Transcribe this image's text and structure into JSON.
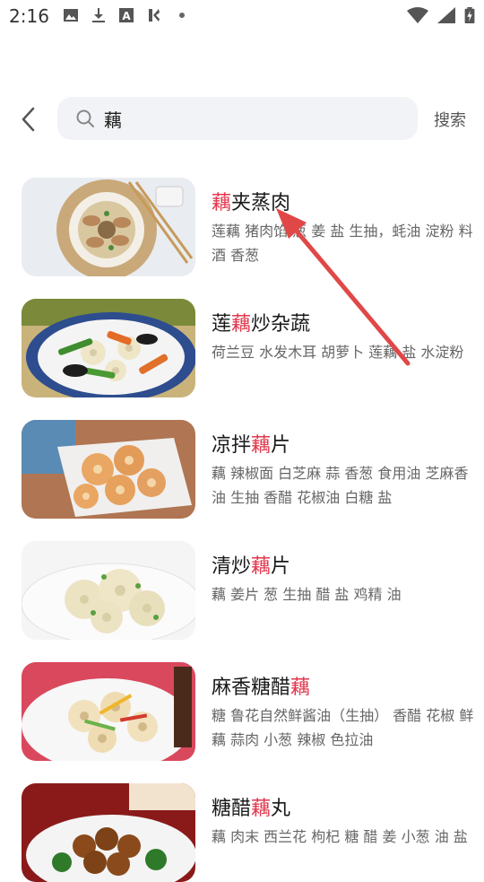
{
  "status_bar": {
    "time": "2:16",
    "left_icons": [
      "image-icon",
      "download-icon",
      "font-app-icon",
      "k-app-icon",
      "dot-icon"
    ],
    "right_icons": [
      "wifi-icon",
      "signal-icon",
      "battery-charging-icon"
    ]
  },
  "search": {
    "query": "藕",
    "button_label": "搜索"
  },
  "colors": {
    "highlight": "#e23a4f",
    "search_bg": "#f1f3f6",
    "arrow": "#e04848"
  },
  "results": [
    {
      "title_pre": "",
      "title_hl": "藕",
      "title_post": "夹蒸肉",
      "ingredients": "莲藕 猪肉馅 葱 姜 盐 生抽，蚝油 淀粉 料酒 香葱"
    },
    {
      "title_pre": "莲",
      "title_hl": "藕",
      "title_post": "炒杂蔬",
      "ingredients": "荷兰豆 水发木耳 胡萝卜 莲藕 盐 水淀粉"
    },
    {
      "title_pre": "凉拌",
      "title_hl": "藕",
      "title_post": "片",
      "ingredients": "藕 辣椒面 白芝麻 蒜 香葱 食用油 芝麻香油 生抽 香醋 花椒油 白糖 盐"
    },
    {
      "title_pre": "清炒",
      "title_hl": "藕",
      "title_post": "片",
      "ingredients": "藕 姜片 葱 生抽 醋 盐 鸡精 油"
    },
    {
      "title_pre": "麻香糖醋",
      "title_hl": "藕",
      "title_post": "",
      "ingredients": "糖 鲁花自然鲜酱油（生抽） 香醋 花椒 鲜藕 蒜肉 小葱 辣椒 色拉油"
    },
    {
      "title_pre": "糖醋",
      "title_hl": "藕",
      "title_post": "丸",
      "ingredients": "藕 肉末 西兰花 枸杞 糖 醋 姜 小葱 油 盐"
    }
  ]
}
